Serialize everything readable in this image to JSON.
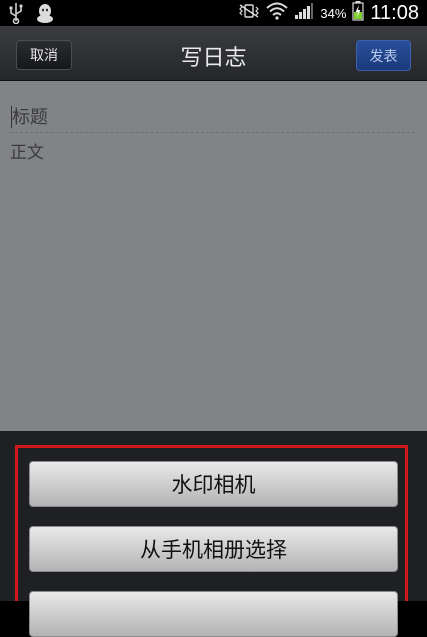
{
  "status_bar": {
    "battery_percent": "34%",
    "time": "11:08",
    "icons": [
      "usb-icon",
      "qq-penguin-icon",
      "vibrate-icon",
      "wifi-icon",
      "signal-icon",
      "battery-charging-icon"
    ]
  },
  "header": {
    "cancel_label": "取消",
    "title": "写日志",
    "publish_label": "发表"
  },
  "editor": {
    "title_placeholder": "标题",
    "body_placeholder": "正文"
  },
  "action_sheet": {
    "options": [
      {
        "label": "水印相机"
      },
      {
        "label": "从手机相册选择"
      },
      {
        "label": ""
      }
    ]
  },
  "colors": {
    "highlight_border": "#d2191c",
    "publish_button": "#1f448c",
    "content_dimmed": "#828387"
  }
}
